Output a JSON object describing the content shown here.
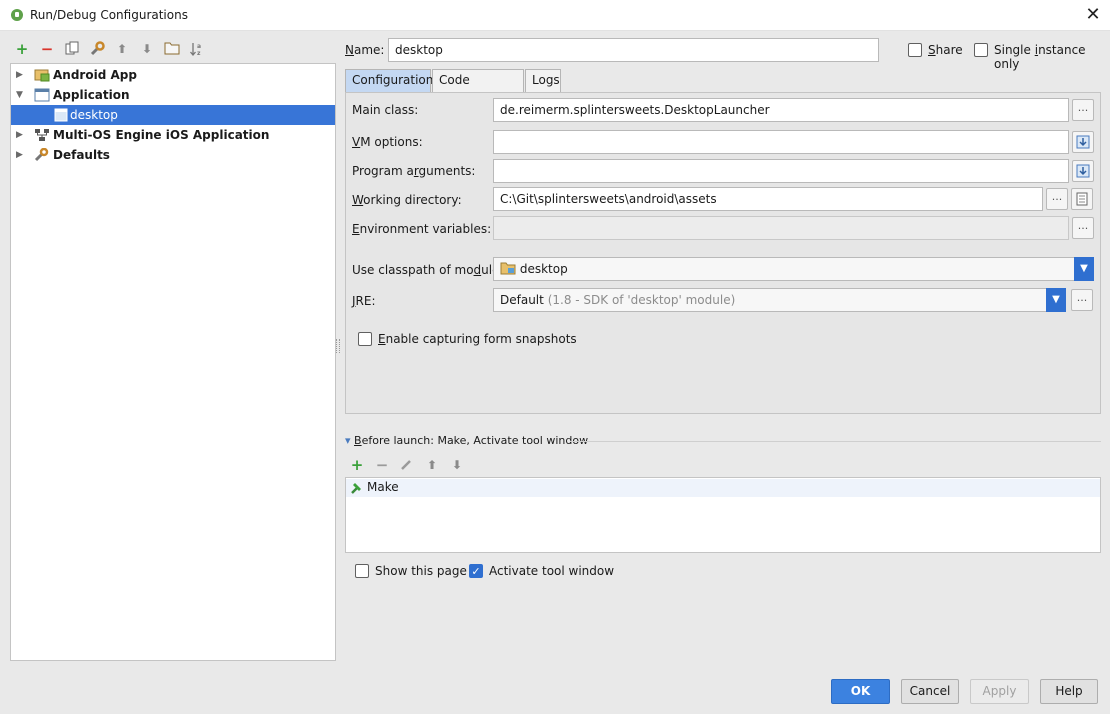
{
  "window": {
    "title": "Run/Debug Configurations",
    "close_glyph": "✕"
  },
  "left_toolbar": {
    "icons": [
      "add-icon",
      "remove-icon",
      "copy-icon",
      "wrench-icon",
      "move-up-icon",
      "move-down-icon",
      "folder-icon",
      "sort-icon"
    ],
    "add_glyph": "+",
    "remove_glyph": "−",
    "up_glyph": "⬆",
    "down_glyph": "⬇"
  },
  "tree": {
    "items": [
      {
        "label": "Android App",
        "expanded": false
      },
      {
        "label": "Application",
        "expanded": true
      },
      {
        "label": "desktop",
        "selected": true
      },
      {
        "label": "Multi-OS Engine iOS Application",
        "expanded": false
      },
      {
        "label": "Defaults",
        "expanded": false
      }
    ]
  },
  "header": {
    "name_label_u": "N",
    "name_label_rest": "ame:",
    "name_value": "desktop",
    "share_label_u": "S",
    "share_label_rest": "hare",
    "share_checked": false,
    "single_instance_pre": "Single ",
    "single_instance_u": "i",
    "single_instance_rest": "nstance only",
    "single_instance_checked": false
  },
  "tabs": [
    {
      "label": "Configuration",
      "active": true
    },
    {
      "label": "Code Coverage",
      "active": false
    },
    {
      "label": "Logs",
      "active": false
    }
  ],
  "config": {
    "main_class_label": "Main class:",
    "main_class_value": "de.reimerm.splintersweets.DesktopLauncher",
    "vm_options_label_u": "V",
    "vm_options_label_rest": "M options:",
    "vm_options_value": "",
    "program_args_pre": "Program a",
    "program_args_u": "r",
    "program_args_rest": "guments:",
    "program_args_value": "",
    "working_dir_u": "W",
    "working_dir_rest": "orking directory:",
    "working_dir_value": "C:\\Git\\splintersweets\\android\\assets",
    "env_vars_u": "E",
    "env_vars_rest": "nvironment variables:",
    "env_vars_value": "",
    "classpath_pre": "Use classpath of mo",
    "classpath_u": "d",
    "classpath_rest": "ule:",
    "classpath_value": "desktop",
    "jre_u": "J",
    "jre_rest": "RE:",
    "jre_value": "Default",
    "jre_detail": "(1.8 - SDK of 'desktop' module)",
    "enable_capture_u": "E",
    "enable_capture_rest": "nable capturing form snapshots",
    "enable_capture_checked": false,
    "ellipsis": "...",
    "dropdown_glyph": "▼"
  },
  "before_launch": {
    "title_u": "B",
    "title_rest": "efore launch: Make, Activate tool window",
    "collapse_glyph": "▾",
    "toolbar_icons": [
      "add-icon",
      "remove-icon",
      "edit-icon",
      "move-up-icon",
      "move-down-icon"
    ],
    "tasks": [
      "Make"
    ],
    "show_page_label": "Show this page",
    "show_page_checked": false,
    "activate_tool_label": "Activate tool window",
    "activate_tool_checked": true,
    "check_glyph": "✓"
  },
  "buttons": {
    "ok": "OK",
    "cancel": "Cancel",
    "apply": "Apply",
    "help": "Help"
  },
  "colors": {
    "selection": "#3875d7",
    "primary_button": "#3c82e0",
    "add_green": "#3aa13a",
    "remove_red": "#d9342b"
  }
}
